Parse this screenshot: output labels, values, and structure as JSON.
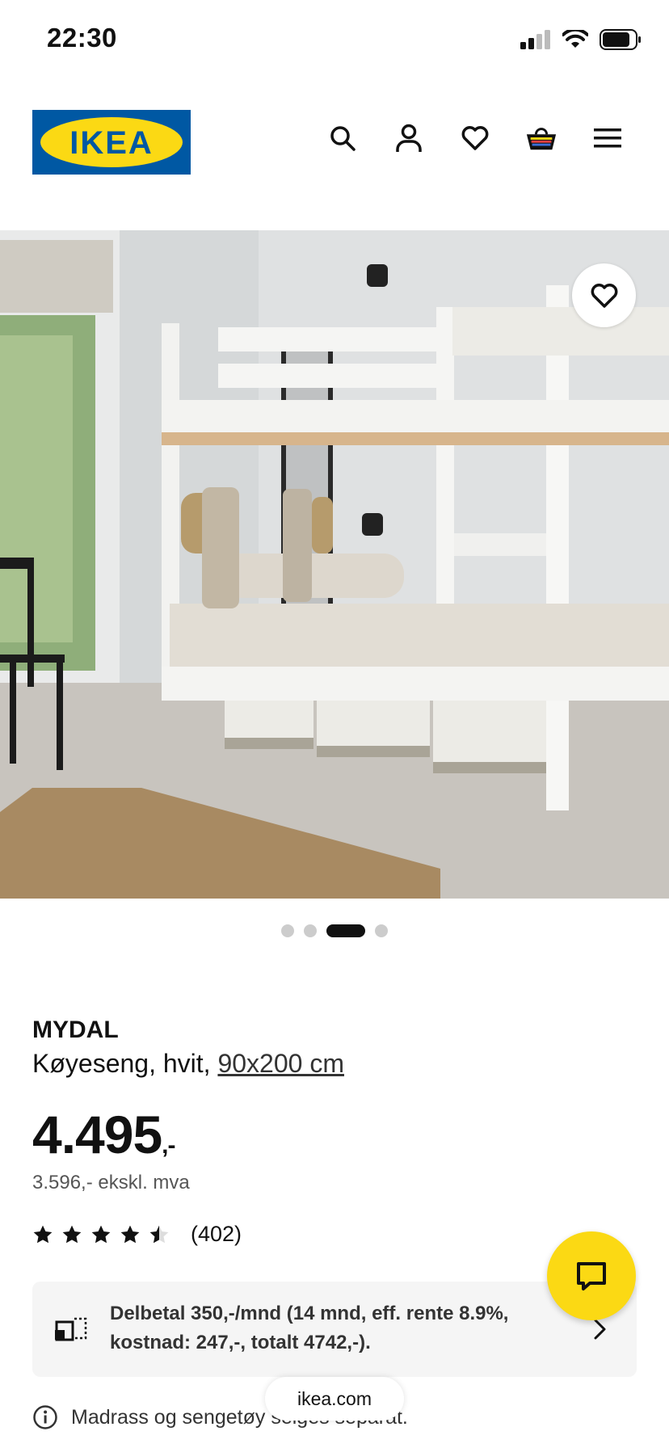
{
  "status_bar": {
    "time": "22:30"
  },
  "header": {
    "logo_text": "IKEA",
    "icons": [
      "search-icon",
      "user-icon",
      "heart-icon",
      "basket-icon",
      "menu-icon"
    ],
    "brand_blue": "#0058a3",
    "brand_yellow": "#fbd914"
  },
  "carousel": {
    "dots": 4,
    "active_index": 2
  },
  "product": {
    "name": "MYDAL",
    "description": "Køyeseng, hvit,",
    "size": "90x200 cm",
    "price": "4.495",
    "price_suffix": ",-",
    "price_ex_vat": "3.596,- ekskl. mva",
    "rating": 4.5,
    "rating_count": "(402)"
  },
  "installment": {
    "text": "Delbetal 350,-/mnd (14 mnd, eff. rente 8.9%, kostnad: 247,-, totalt 4742,-)."
  },
  "footer": {
    "info_text": "Madrass og sengetøy selges separat.",
    "url": "ikea.com"
  }
}
